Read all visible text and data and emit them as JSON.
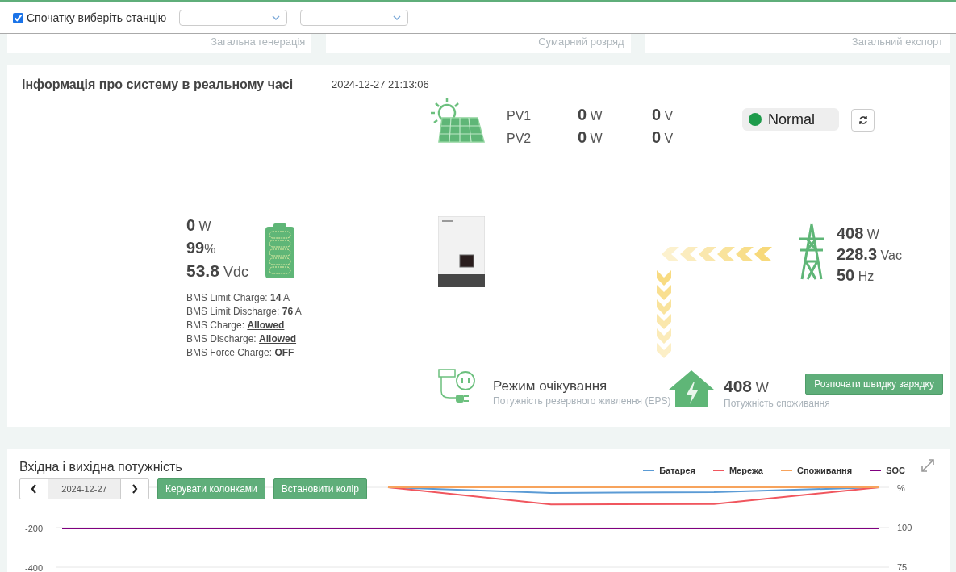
{
  "header": {
    "station_checkbox": {
      "label": "Спочатку виберіть станцію",
      "checked": true
    },
    "selects": [
      {
        "kind": "masked"
      },
      {
        "kind": "text",
        "value": "--"
      }
    ]
  },
  "stats": [
    {
      "label": "Загальна генерація"
    },
    {
      "label": "Сумарний розряд"
    },
    {
      "label": "Загальний експорт"
    }
  ],
  "realtime": {
    "title": "Інформація про систему в реальному часі",
    "timestamp": "2024-12-27 21:13:06",
    "pv": [
      {
        "name": "PV1",
        "power": "0",
        "power_unit": "W",
        "voltage": "0",
        "voltage_unit": "V"
      },
      {
        "name": "PV2",
        "power": "0",
        "power_unit": "W",
        "voltage": "0",
        "voltage_unit": "V"
      }
    ],
    "status": {
      "label": "Normal",
      "ok": true
    },
    "battery": {
      "power": "0",
      "power_unit": "W",
      "soc": "99",
      "soc_unit": "%",
      "voltage": "53.8",
      "voltage_unit": "Vdc"
    },
    "bms": [
      {
        "label": "BMS Limit Charge:",
        "value": "14",
        "unit": "A",
        "kind": "plain"
      },
      {
        "label": "BMS Limit Discharge:",
        "value": "76",
        "unit": "A",
        "kind": "plain"
      },
      {
        "label": "BMS Charge:",
        "value": "Allowed",
        "kind": "link"
      },
      {
        "label": "BMS Discharge:",
        "value": "Allowed",
        "kind": "link"
      },
      {
        "label": "BMS Force Charge:",
        "value": "OFF",
        "kind": "plain"
      }
    ],
    "grid": [
      {
        "value": "408",
        "unit": "W"
      },
      {
        "value": "228.3",
        "unit": "Vac"
      },
      {
        "value": "50",
        "unit": "Hz"
      }
    ],
    "flow": {
      "grid_to_load": true
    },
    "eps": {
      "title": "Режим очікування",
      "subtitle": "Потужність резервного живлення (EPS)"
    },
    "load": {
      "value": "408",
      "unit": "W",
      "label": "Потужність споживання"
    },
    "quick_charge_button": "Розпочати швидку зарядку"
  },
  "power_chart": {
    "title": "Вхідна і вихідна потужність",
    "date": "2024-12-27",
    "buttons": [
      "Керувати колонками",
      "Встановити колір"
    ],
    "right_axis_ticks": [
      "%",
      "100",
      "75"
    ],
    "soc_series": {
      "name": "SOC",
      "color": "#800080"
    },
    "chart_data": {
      "type": "line",
      "ylim": [
        -400,
        0
      ],
      "yticks": [
        -200,
        -400
      ],
      "series": [
        {
          "name": "Батарея",
          "color": "#5b9bd5",
          "values": [
            null,
            null,
            0,
            -28,
            -24,
            0
          ]
        },
        {
          "name": "Мережа",
          "color": "#f0565e",
          "values": [
            null,
            null,
            0,
            -86,
            -84,
            0
          ]
        },
        {
          "name": "Споживання",
          "color": "#f7a35c",
          "values": [
            null,
            null,
            0,
            0,
            0,
            0
          ]
        }
      ]
    }
  }
}
